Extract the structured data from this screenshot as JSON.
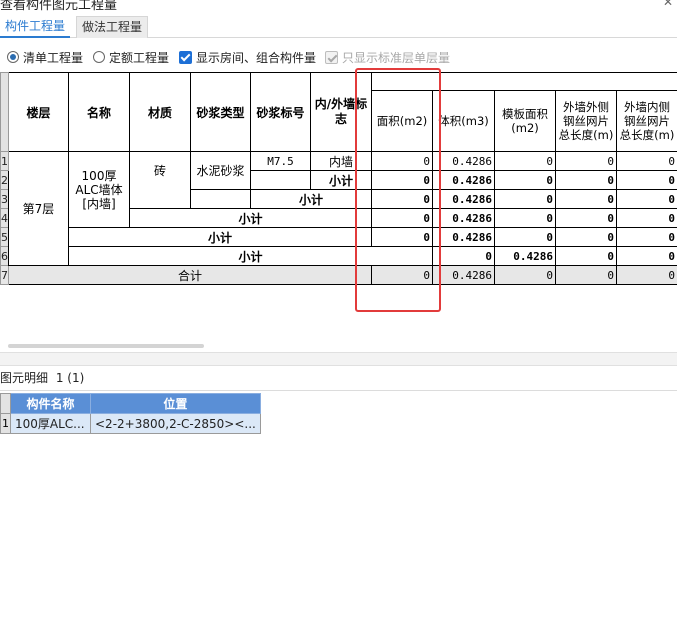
{
  "window": {
    "title": "查看构件图元工程量",
    "close_glyph": "✕"
  },
  "tabs": [
    {
      "label": "构件工程量"
    },
    {
      "label": "做法工程量"
    }
  ],
  "options": {
    "qingdan": "清单工程量",
    "dinge": "定额工程量",
    "show_rooms": "显示房间、组合构件量",
    "std_floor_only": "只显示标准层单层量"
  },
  "grid": {
    "headers": {
      "floor": "楼层",
      "name": "名称",
      "material": "材质",
      "mortar_type": "砂浆类型",
      "mortar_grade": "砂浆标号",
      "inout": "内/外墙标志",
      "area": "面积(m2)",
      "volume": "体积(m3)",
      "formwork": "模板面积(m2)",
      "ext_mesh": "外墙外侧钢丝网片总长度(m)",
      "int_mesh": "外墙内侧钢丝网片总长度(m)"
    },
    "row_numbers": [
      "1",
      "2",
      "3",
      "4",
      "5",
      "6",
      "7"
    ],
    "floor": "第7层",
    "name": "100厚ALC墙体 [内墙]",
    "material": "砖",
    "mortar_type": "水泥砂浆",
    "mortar_grade": "M7.5",
    "inout": "内墙",
    "subtotal": "小计",
    "total": "合计",
    "values": {
      "area": "0",
      "volume": "0.4286",
      "formwork": "0",
      "ext_mesh": "0",
      "int_mesh": "0"
    }
  },
  "detail": {
    "title": "图元明细",
    "count": "1 (1)",
    "headers": {
      "name": "构件名称",
      "position": "位置"
    },
    "rows": [
      {
        "num": "1",
        "name": "100厚ALC...",
        "position": "<2-2+3800,2-C-2850><..."
      }
    ]
  }
}
